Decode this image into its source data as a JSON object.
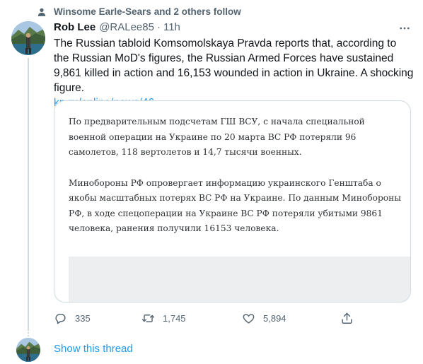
{
  "social_context": {
    "text": "Winsome Earle-Sears and 2 others follow",
    "icon": "person-icon"
  },
  "tweet": {
    "author_name": "Rob Lee",
    "handle": "@RALee85",
    "separator": "·",
    "time": "11h",
    "text": "The Russian tabloid Komsomolskaya Pravda reports that, according to the Russian MoD's figures, the Russian Armed Forces have sustained 9,861 killed in action and 16,153 wounded in action in Ukraine. A shocking figure.",
    "link_text": "kp.ru/online/news/46…",
    "more_icon": "more-icon"
  },
  "card": {
    "paragraph_1": "По предварительным подсчетам ГШ ВСУ, с начала специальной военной операции на Украине по 20 марта ВС РФ потеряли 96 самолетов, 118 вертолетов и 14,7 тысячи военных.",
    "paragraph_2": "Минобороны РФ опровергает информацию украинского Генштаба о якобы масштабных потерях ВС РФ на Украине. По данным Минобороны РФ, в ходе спецоперации на Украине ВС РФ потеряли убитыми 9861 человека, ранения получили 16153 человека."
  },
  "actions": {
    "reply": {
      "icon": "reply-icon",
      "count": "335"
    },
    "retweet": {
      "icon": "retweet-icon",
      "count": "1,745"
    },
    "like": {
      "icon": "heart-icon",
      "count": "5,894"
    },
    "share": {
      "icon": "share-icon"
    }
  },
  "show_thread": "Show this thread",
  "colors": {
    "accent": "#1d9bf0",
    "secondary_text": "#536471",
    "primary_text": "#0f1419",
    "border": "#cfd9de"
  }
}
